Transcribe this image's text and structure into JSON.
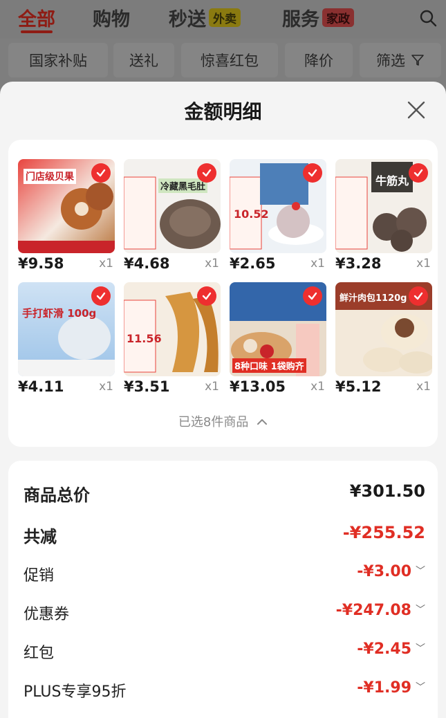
{
  "nav": {
    "tabs": [
      {
        "label": "全部",
        "active": true
      },
      {
        "label": "购物"
      },
      {
        "label": "秒送",
        "badge": "外卖"
      },
      {
        "label": "服务",
        "badge": "家政"
      }
    ]
  },
  "filters": [
    "国家补贴",
    "送礼",
    "惊喜红包",
    "降价",
    "筛选"
  ],
  "sheet": {
    "title": "金额明细",
    "products": [
      {
        "price": "¥9.58",
        "qty": "x1",
        "thumb_text": "门店级贝果",
        "thumb_color": "#d8343c"
      },
      {
        "price": "¥4.68",
        "qty": "x1",
        "thumb_text": "冷藏黑毛肚",
        "thumb_color": "#6d5a4e"
      },
      {
        "price": "¥2.65",
        "qty": "x1",
        "thumb_text": "10.52",
        "thumb_color": "#c8d3de"
      },
      {
        "price": "¥3.28",
        "qty": "x1",
        "thumb_text": "牛筋丸",
        "thumb_color": "#5a4a42"
      },
      {
        "price": "¥4.11",
        "qty": "x1",
        "thumb_text": "手打虾滑 100g",
        "thumb_color": "#8fb9e0"
      },
      {
        "price": "¥3.51",
        "qty": "x1",
        "thumb_text": "11.56",
        "thumb_color": "#d69640"
      },
      {
        "price": "¥13.05",
        "qty": "x1",
        "thumb_text": "8种口味 1袋购齐",
        "thumb_color": "#3366aa"
      },
      {
        "price": "¥5.12",
        "qty": "x1",
        "thumb_text": "鲜汁肉包1120g",
        "thumb_color": "#caa472"
      }
    ],
    "selected_count": "已选8件商品"
  },
  "summary": {
    "total_label": "商品总价",
    "total_value": "¥301.50",
    "discount_label": "共减",
    "discount_value": "-¥255.52",
    "items": [
      {
        "label": "促销",
        "value": "-¥3.00"
      },
      {
        "label": "优惠券",
        "value": "-¥247.08"
      },
      {
        "label": "红包",
        "value": "-¥2.45"
      },
      {
        "label": "PLUS专享95折",
        "value": "-¥1.99"
      }
    ]
  },
  "colors": {
    "accent_red": "#e02e24",
    "check_red": "#ee2f2f"
  }
}
